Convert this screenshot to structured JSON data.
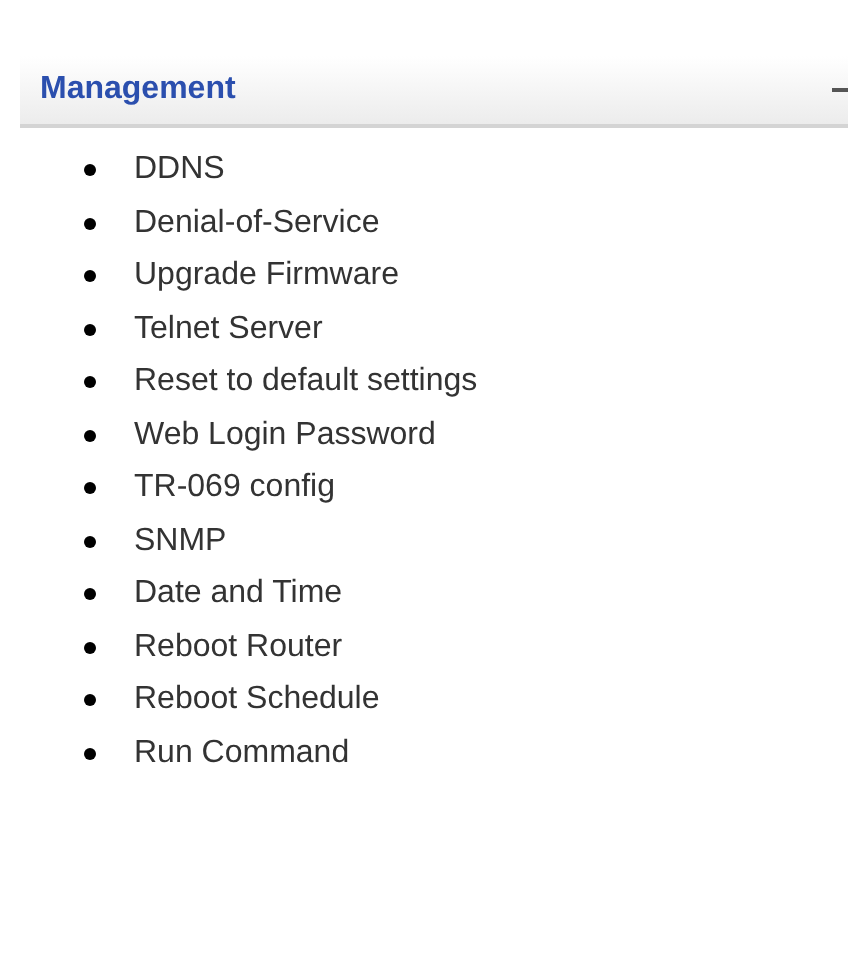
{
  "section": {
    "title": "Management",
    "expanded": true,
    "items": [
      {
        "label": "DDNS"
      },
      {
        "label": "Denial-of-Service"
      },
      {
        "label": "Upgrade Firmware"
      },
      {
        "label": "Telnet Server"
      },
      {
        "label": "Reset to default settings"
      },
      {
        "label": "Web Login Password"
      },
      {
        "label": "TR-069 config"
      },
      {
        "label": "SNMP"
      },
      {
        "label": "Date and Time"
      },
      {
        "label": "Reboot Router"
      },
      {
        "label": "Reboot Schedule"
      },
      {
        "label": "Run Command"
      }
    ]
  }
}
